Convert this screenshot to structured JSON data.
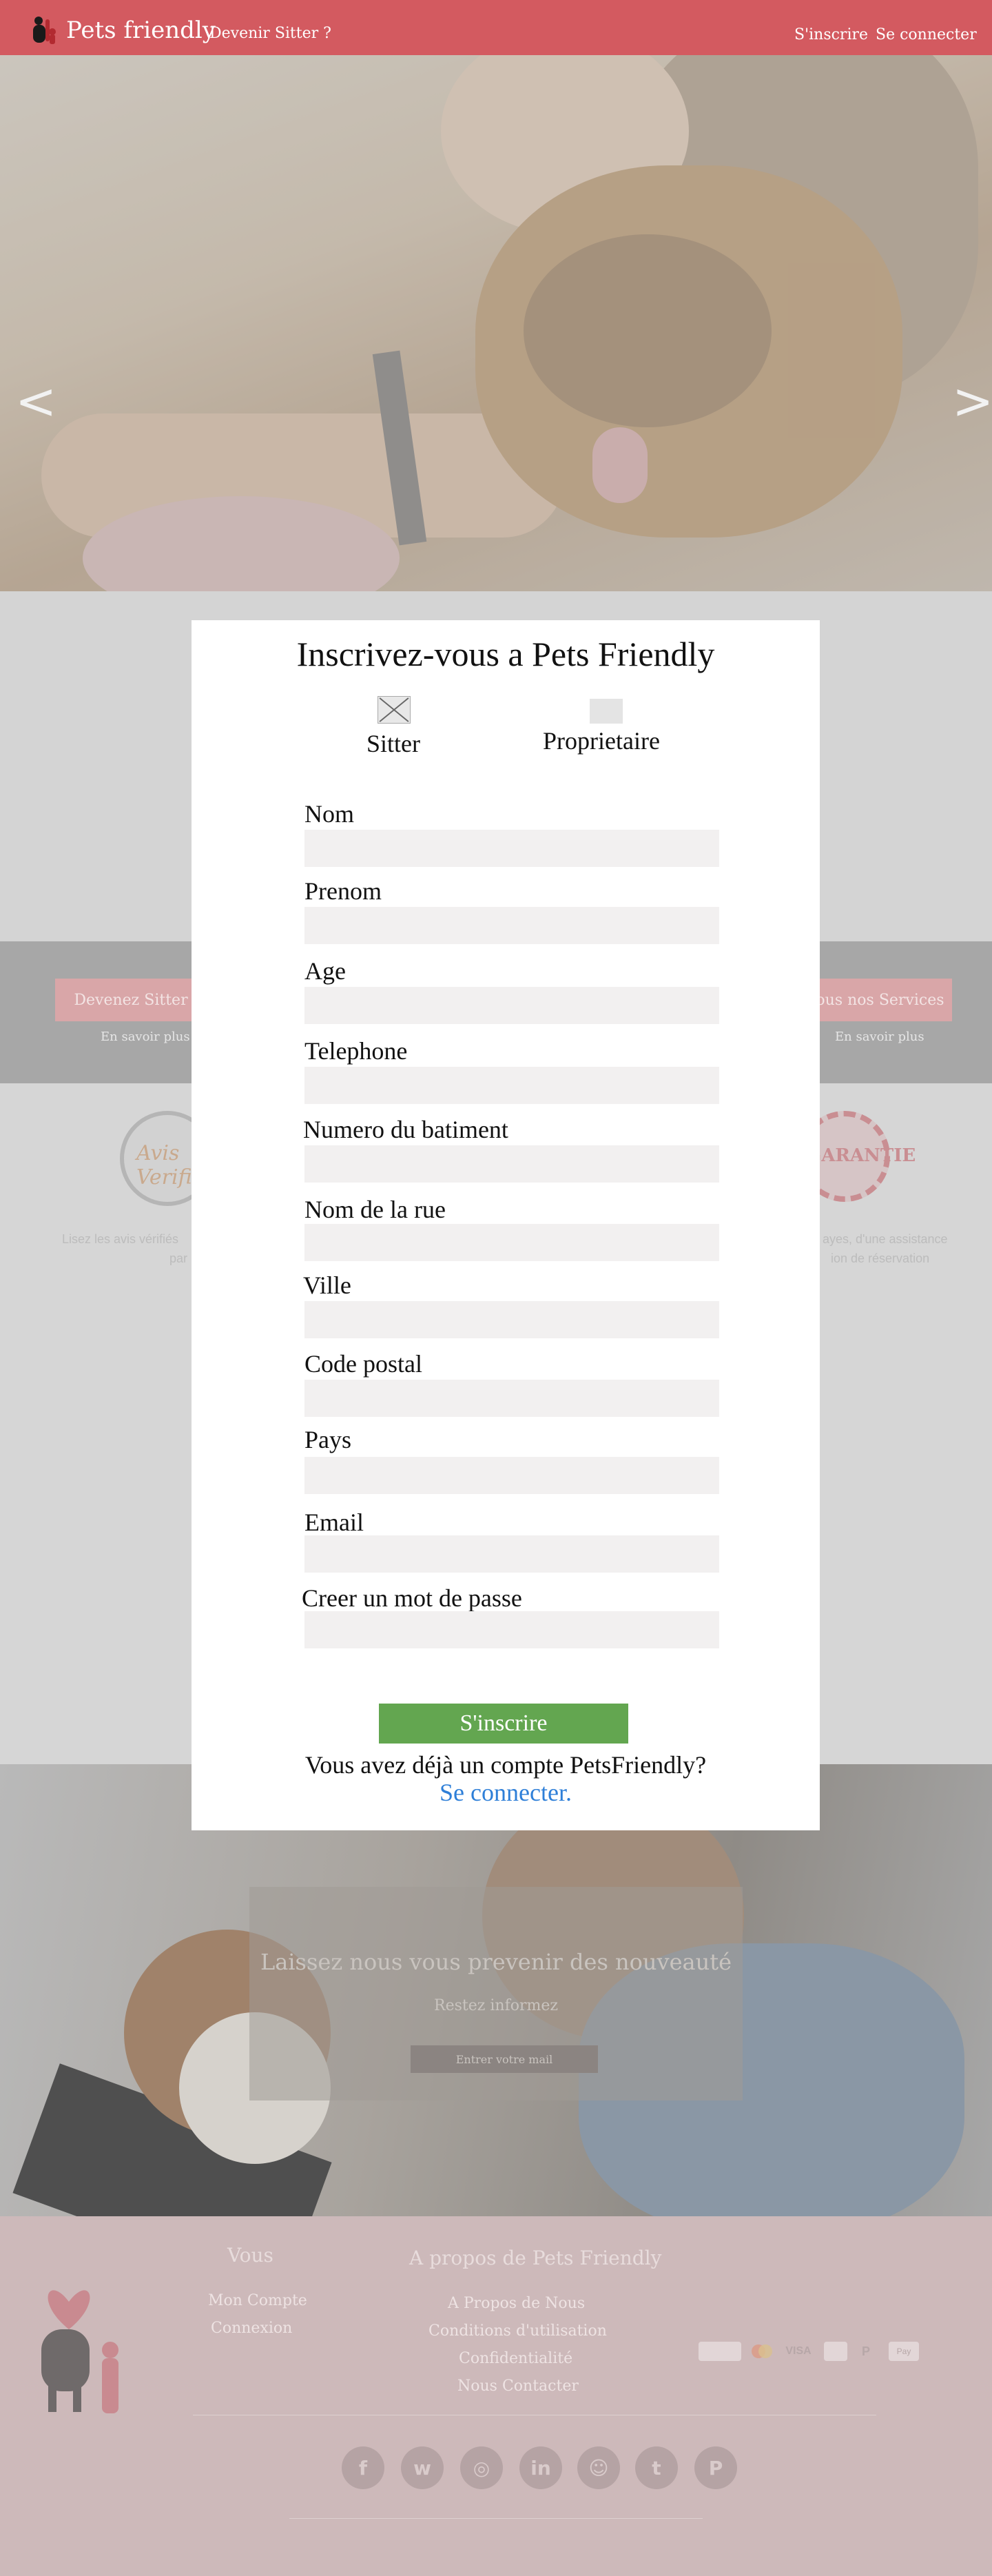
{
  "header": {
    "brand": "Pets friendly",
    "become_sitter": "Devenir Sitter ?",
    "signup": "S'inscrire",
    "login": "Se connecter"
  },
  "hero": {
    "prev_arrow": "<",
    "next_arrow": ">"
  },
  "strip": {
    "left_button": "Devenez Sitter",
    "left_sub": "En savoir plus",
    "right_button": "Tous nos Services",
    "right_sub": "En savoir plus"
  },
  "badges": {
    "left_badge_text": "Avis Verifie",
    "right_badge_text": "GARANTIE",
    "left_text_1": "Lisez les avis vérifiés",
    "left_text_2": "par",
    "right_text_1": "ayes, d'une assistance",
    "right_text_2": "ion de réservation"
  },
  "newsletter": {
    "title": "Laissez nous vous prevenir des nouveauté",
    "subtitle": "Restez informez",
    "input_placeholder": "Entrer votre mail"
  },
  "footer": {
    "col1_title": "Vous",
    "col1_links": [
      "Mon Compte",
      "Connexion"
    ],
    "col2_title": "A propos de Pets Friendly",
    "col2_links": [
      "A Propos de Nous",
      "Conditions d'utilisation",
      "Confidentialité",
      "Nous Contacter"
    ],
    "payments": [
      "",
      "",
      "VISA",
      "",
      "P",
      "Pay"
    ],
    "social": [
      "f",
      "w",
      "◎",
      "in",
      "☺",
      "t",
      "P"
    ]
  },
  "modal": {
    "title": "Inscrivez-vous a Pets Friendly",
    "role_sitter": "Sitter",
    "role_owner": "Proprietaire",
    "sitter_checked": true,
    "owner_checked": false,
    "fields": {
      "nom": "Nom",
      "prenom": "Prenom",
      "age": "Age",
      "telephone": "Telephone",
      "numero": "Numero du batiment",
      "rue": "Nom de la rue",
      "ville": "Ville",
      "code_postal": "Code postal",
      "pays": "Pays",
      "email": "Email",
      "mot_de_passe": "Creer un mot de passe"
    },
    "submit": "S'inscrire",
    "already": "Vous avez déjà un compte PetsFriendly?",
    "login_link": "Se connecter."
  },
  "colors": {
    "header": "#d35a60",
    "submit": "#63a650",
    "link": "#2e7fd8",
    "input_bg": "#f2f0f0"
  }
}
